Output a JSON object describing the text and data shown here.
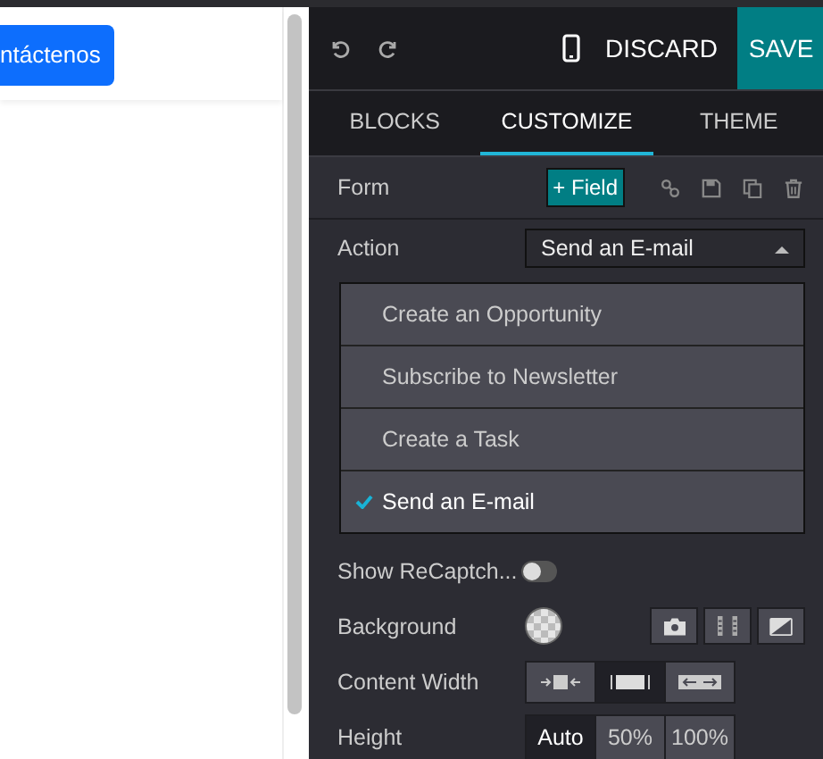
{
  "canvas": {
    "button": "ntáctenos"
  },
  "toolbar": {
    "discard": "DISCARD",
    "save": "SAVE"
  },
  "tabs": [
    {
      "label": "BLOCKS",
      "selected": false
    },
    {
      "label": "CUSTOMIZE",
      "selected": true
    },
    {
      "label": "THEME",
      "selected": false
    }
  ],
  "form": {
    "title": "Form",
    "add_field": "+ Field"
  },
  "action": {
    "label": "Action",
    "value": "Send an E-mail",
    "expanded": true,
    "options": [
      {
        "label": "Create an Opportunity",
        "selected": false
      },
      {
        "label": "Subscribe to Newsletter",
        "selected": false
      },
      {
        "label": "Create a Task",
        "selected": false
      },
      {
        "label": "Send an E-mail",
        "selected": true
      }
    ]
  },
  "recaptcha": {
    "label": "Show ReCaptch...",
    "on": false
  },
  "background": {
    "label": "Background"
  },
  "content_width": {
    "label": "Content Width",
    "options": [
      {
        "kind": "narrow",
        "selected": false
      },
      {
        "kind": "full",
        "selected": true
      },
      {
        "kind": "wide",
        "selected": false
      }
    ]
  },
  "height": {
    "label": "Height",
    "options": [
      {
        "label": "Auto",
        "selected": true
      },
      {
        "label": "50%",
        "selected": false
      },
      {
        "label": "100%",
        "selected": false
      }
    ]
  }
}
